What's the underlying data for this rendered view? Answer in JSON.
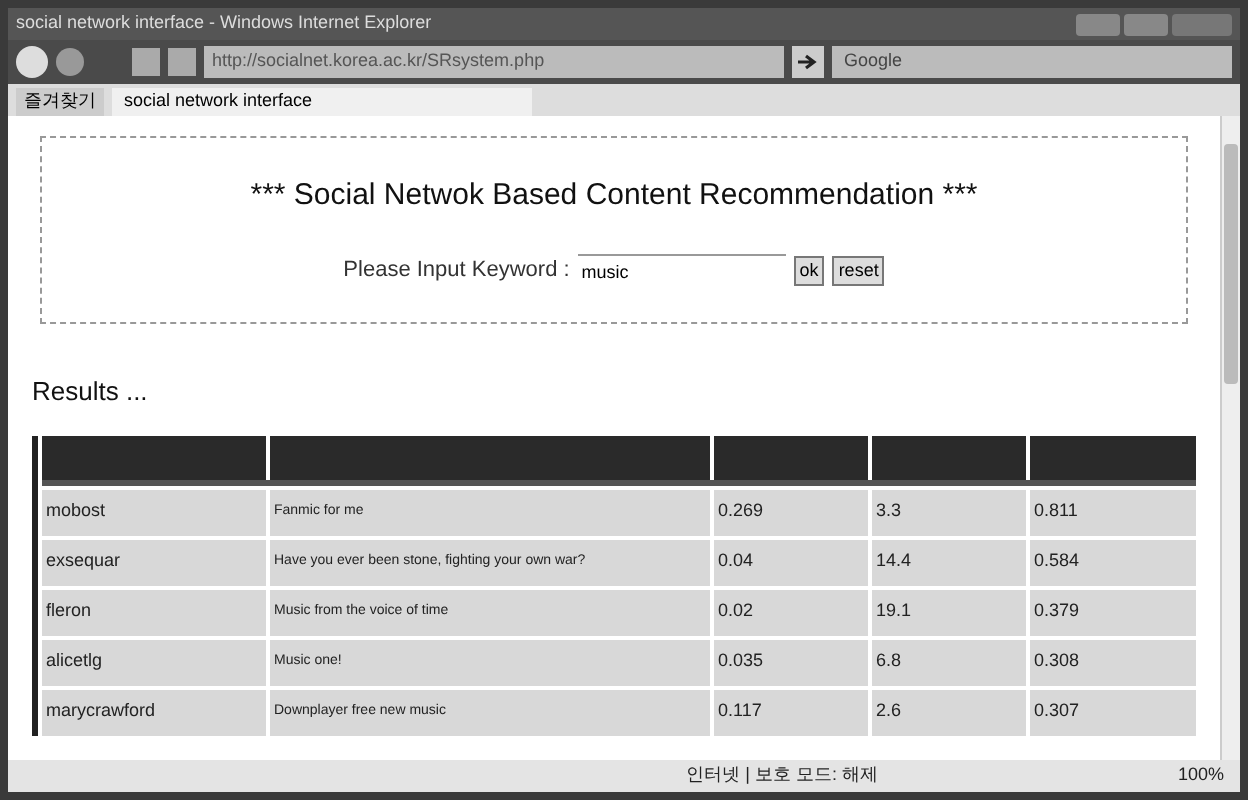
{
  "window": {
    "title": "social network interface - Windows Internet Explorer"
  },
  "address_bar": {
    "url": "http://socialnet.korea.ac.kr/SRsystem.php"
  },
  "search": {
    "value": "Google"
  },
  "favorites": {
    "label": "즐겨찾기"
  },
  "tabs": [
    {
      "label": "social network interface",
      "selected": true
    }
  ],
  "page": {
    "heading": "*** Social Netwok Based Content Recommendation ***",
    "keyword_label": "Please Input Keyword :",
    "keyword_value": "music",
    "buttons": [
      "ok",
      "reset"
    ],
    "results_title": "Results ..."
  },
  "table": {
    "rows": [
      [
        "mobost",
        "Fanmic for me",
        "0.269",
        "3.3",
        "0.811"
      ],
      [
        "exsequar",
        "Have you ever been stone, fighting your own war?",
        "0.04",
        "14.4",
        "0.584"
      ],
      [
        "fleron",
        "Music from the voice of time",
        "0.02",
        "19.1",
        "0.379"
      ],
      [
        "alicetlg",
        "Music one!",
        "0.035",
        "6.8",
        "0.308"
      ],
      [
        "marycrawford",
        "Downplayer free new music",
        "0.117",
        "2.6",
        "0.307"
      ]
    ]
  },
  "status_bar": {
    "zone": "인터넷 | 보호 모드: 해제",
    "zoom": "100%"
  }
}
